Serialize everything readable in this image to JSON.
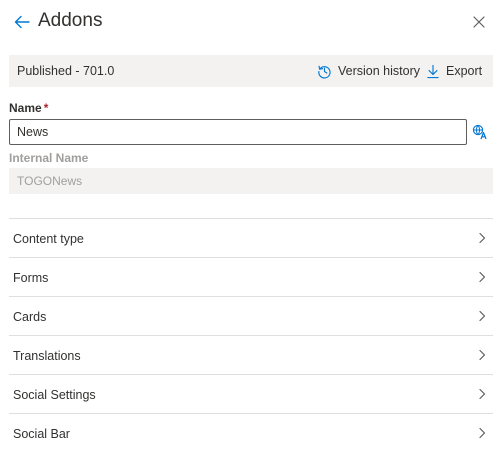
{
  "header": {
    "title": "Addons",
    "back_icon": "arrow-left-icon",
    "close_icon": "close-icon",
    "accent_color": "#0078d4"
  },
  "status_bar": {
    "text": "Published - 701.0",
    "version_history_label": "Version history",
    "version_history_icon": "history-icon",
    "export_label": "Export",
    "export_icon": "download-icon"
  },
  "form": {
    "name_label": "Name",
    "name_required_mark": "*",
    "name_value": "News",
    "translate_icon": "translate-icon",
    "internal_name_label": "Internal Name",
    "internal_name_value": "TOGONews"
  },
  "list": {
    "items": [
      {
        "label": "Content type"
      },
      {
        "label": "Forms"
      },
      {
        "label": "Cards"
      },
      {
        "label": "Translations"
      },
      {
        "label": "Social Settings"
      },
      {
        "label": "Social Bar"
      }
    ],
    "chevron_icon": "chevron-right-icon"
  }
}
